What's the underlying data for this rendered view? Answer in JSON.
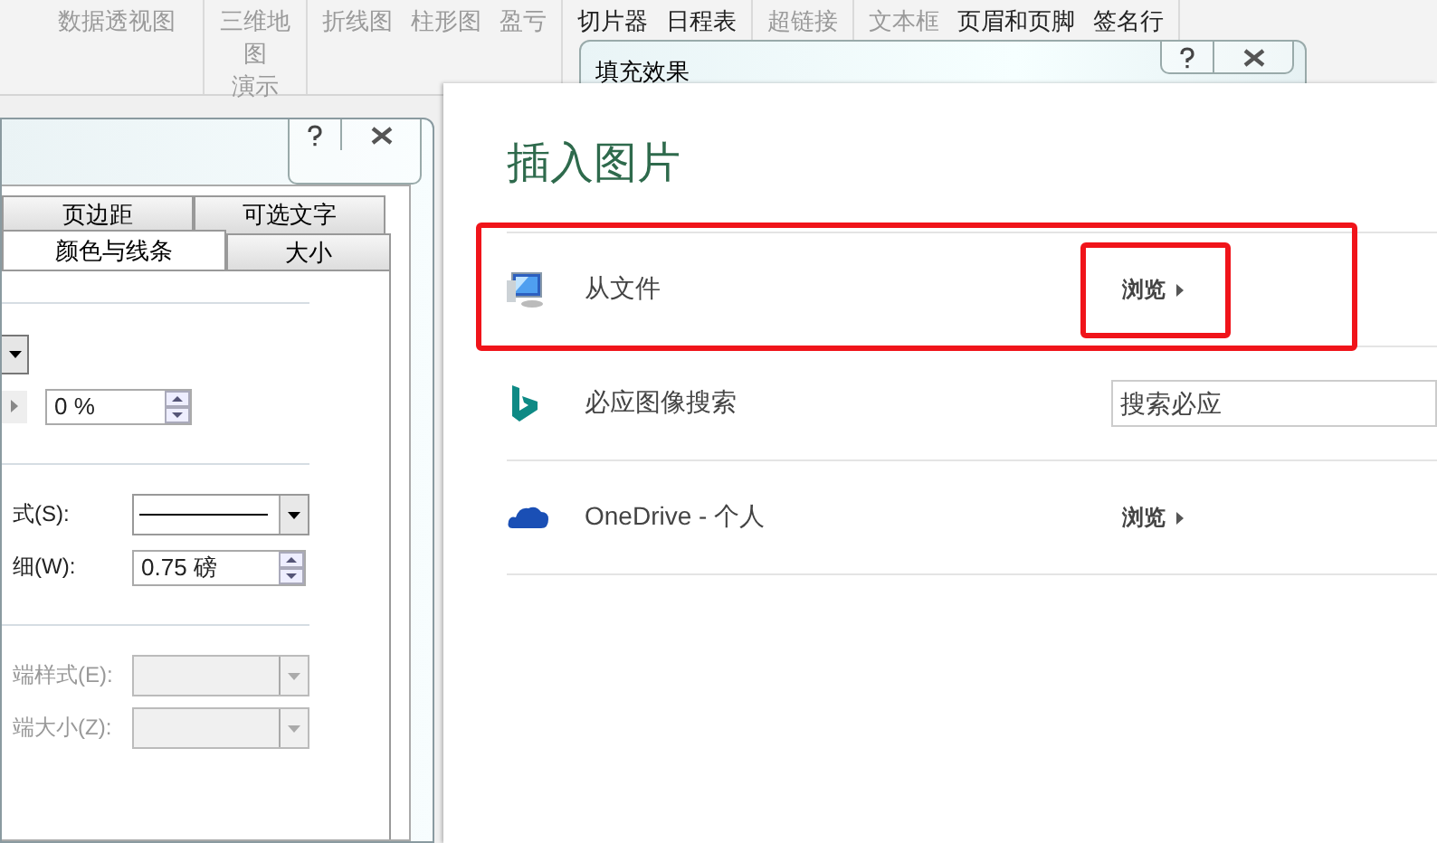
{
  "ribbon": {
    "groups": [
      {
        "items": [
          {
            "label": "数据透视图",
            "disabled": true
          }
        ]
      },
      {
        "items": [
          {
            "label": "三维地图",
            "disabled": true
          }
        ],
        "caption": {
          "label": "演示",
          "disabled": true
        }
      },
      {
        "items": [
          {
            "label": "折线图",
            "disabled": true
          },
          {
            "label": "柱形图",
            "disabled": true
          },
          {
            "label": "盈亏",
            "disabled": true
          }
        ]
      },
      {
        "items": [
          {
            "label": "切片器",
            "disabled": false
          },
          {
            "label": "日程表",
            "disabled": false
          }
        ]
      },
      {
        "items": [
          {
            "label": "超链接",
            "disabled": true
          }
        ]
      },
      {
        "items": [
          {
            "label": "文本框",
            "disabled": true
          },
          {
            "label": "页眉和页脚",
            "disabled": false
          },
          {
            "label": "签名行",
            "disabled": false
          }
        ]
      }
    ]
  },
  "fill_effects_dialog": {
    "title": "填充效果"
  },
  "format_dialog": {
    "tab_rows": [
      [
        {
          "label": "页边距",
          "selected": false
        },
        {
          "label": "可选文字",
          "selected": false
        }
      ],
      [
        {
          "label": "颜色与线条",
          "selected": true
        },
        {
          "label": "大小",
          "selected": false
        }
      ]
    ],
    "sections": [
      [
        {
          "kind": "dropdown-edge"
        },
        {
          "kind": "slider-spin",
          "value": "0 %"
        }
      ],
      [
        {
          "kind": "line-dropdown",
          "label": "式(S):",
          "disabled": false
        },
        {
          "kind": "spin",
          "label": "细(W):",
          "value": "0.75 磅",
          "disabled": false
        }
      ],
      [
        {
          "kind": "dropdown",
          "label": "端样式(E):",
          "disabled": true
        },
        {
          "kind": "dropdown",
          "label": "端大小(Z):",
          "disabled": true
        }
      ]
    ]
  },
  "insert_picture": {
    "title": "插入图片",
    "sources": [
      {
        "kind": "file",
        "label": "从文件",
        "action": {
          "kind": "browse",
          "label": "浏览"
        },
        "highlighted": true,
        "action_highlighted": true
      },
      {
        "kind": "bing",
        "label": "必应图像搜索",
        "action": {
          "kind": "search",
          "placeholder": "搜索必应"
        },
        "highlighted": false,
        "action_highlighted": false
      },
      {
        "kind": "onedrive",
        "label": "OneDrive - 个人",
        "action": {
          "kind": "browse",
          "label": "浏览"
        },
        "highlighted": false,
        "action_highlighted": false
      }
    ]
  }
}
